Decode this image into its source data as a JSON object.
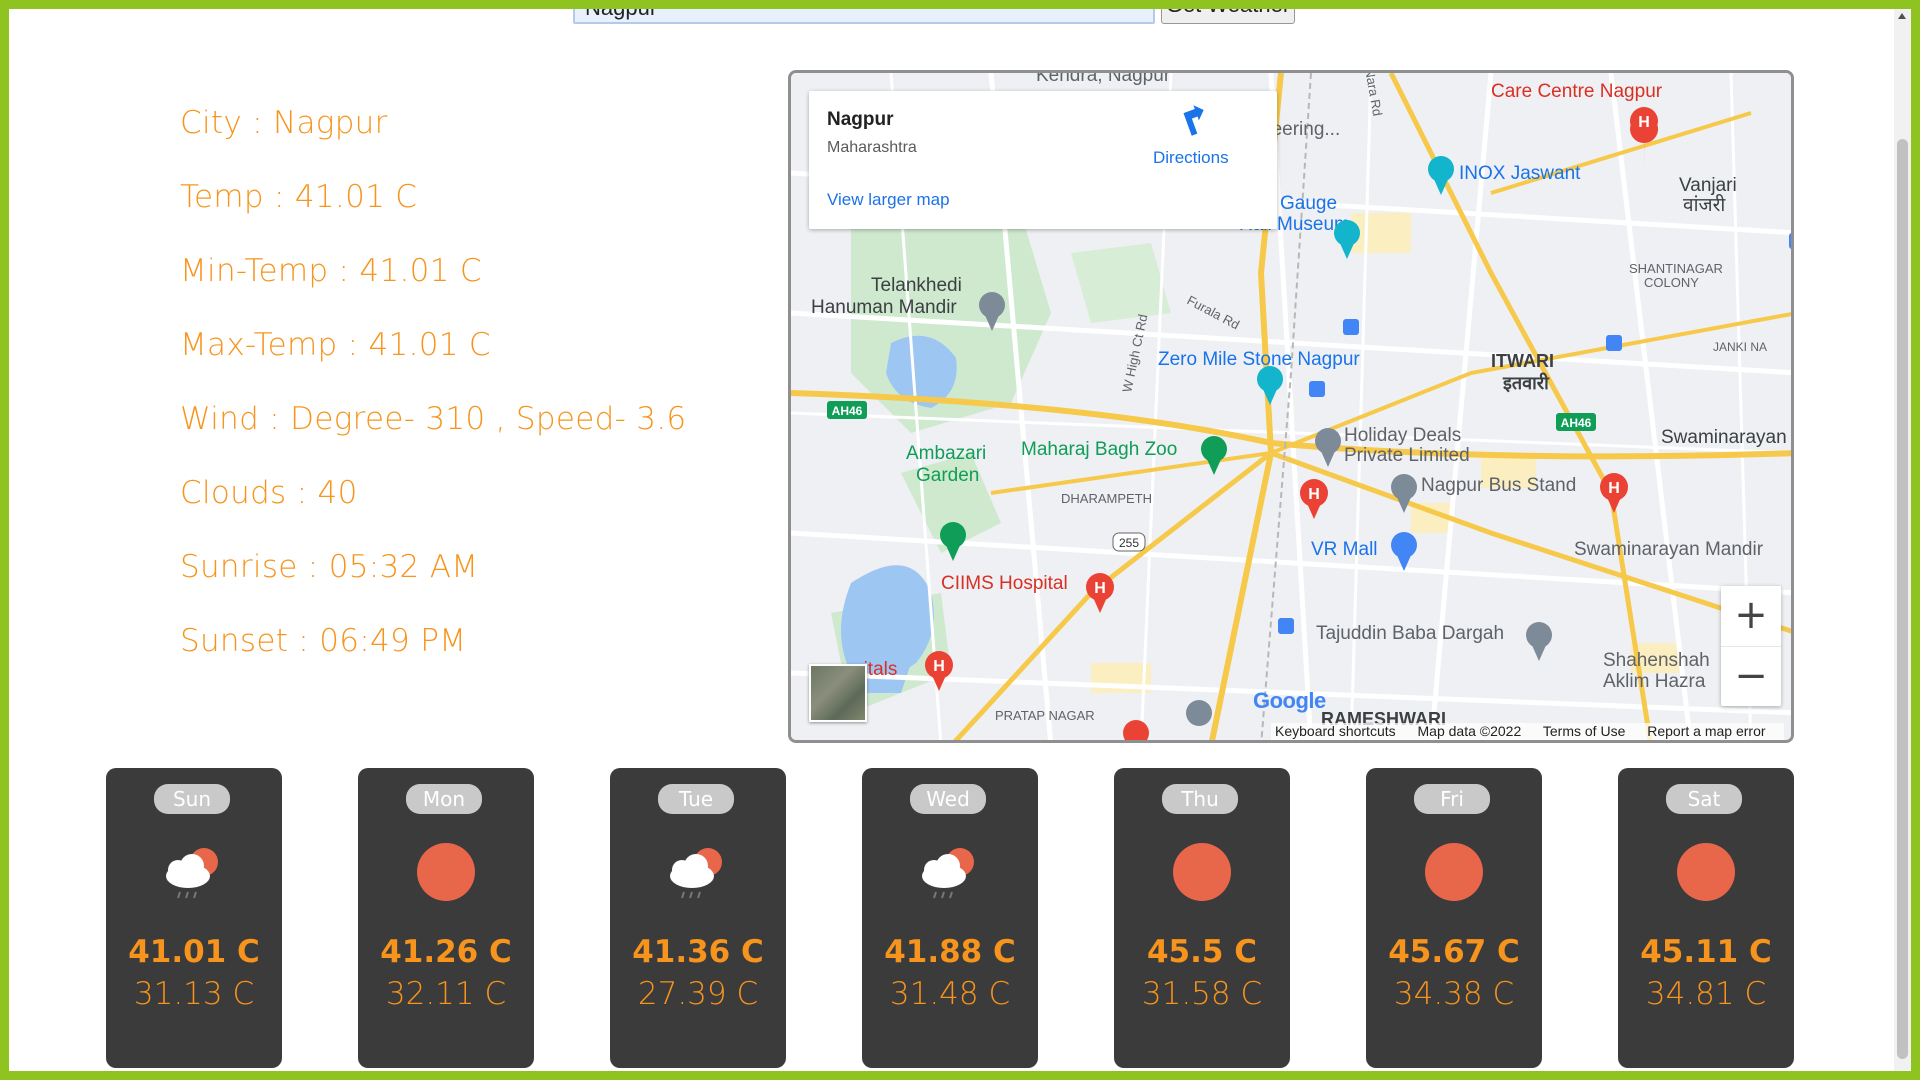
{
  "search": {
    "value": "Nagpur",
    "button_label": "Get Weather"
  },
  "info": {
    "city": "City : Nagpur",
    "temp": "Temp : 41.01 C",
    "min_temp": "Min-Temp : 41.01 C",
    "max_temp": "Max-Temp : 41.01 C",
    "wind": "Wind : Degree- 310 , Speed- 3.6",
    "clouds": "Clouds : 40",
    "sunrise": "Sunrise : 05:32 AM",
    "sunset": "Sunset : 06:49 PM"
  },
  "map": {
    "place_name": "Nagpur",
    "region": "Maharashtra",
    "directions_label": "Directions",
    "view_larger": "View larger map",
    "zoom_in": "+",
    "zoom_out": "−",
    "google": "Google",
    "attribution": {
      "shortcuts": "Keyboard shortcuts",
      "map_data": "Map data ©2022",
      "terms": "Terms of Use",
      "report": "Report a map error"
    },
    "labels": [
      "Kendra, Nagpur",
      "Care Centre Nagpur",
      "INOX Jaswant",
      "Vanjari",
      "वांजरी",
      "Rail Museum",
      "Telankhedi",
      "Hanuman Mandir",
      "SHANTINAGAR",
      "COLONY",
      "ITWARI",
      "इतवारी",
      "Zero Mile Stone Nagpur",
      "Holiday Deals",
      "Private Limited",
      "Swaminarayan",
      "Ambazari",
      "Garden",
      "Maharaj Bagh Zoo",
      "DHARAMPETH",
      "Nagpur Bus Stand",
      "VR Mall",
      "Swaminarayan Mandir",
      "CIIMS Hospital",
      "Tajuddin Baba Dargah",
      "Shahenshah",
      "Aklim Hazra",
      "PRATAP NAGAR",
      "RAMESHWARI",
      "AH46",
      "255",
      "Furala Rd",
      "W High Ct Rd",
      "Nara Rd",
      "JANKI NA",
      "pitals",
      "neering...",
      "w Gauge"
    ]
  },
  "forecast": [
    {
      "day": "Sun",
      "icon": "cloud-sun-rain-icon",
      "hi": "41.01 C",
      "lo": "31.13 C"
    },
    {
      "day": "Mon",
      "icon": "sun-icon",
      "hi": "41.26 C",
      "lo": "32.11 C"
    },
    {
      "day": "Tue",
      "icon": "cloud-sun-rain-icon",
      "hi": "41.36 C",
      "lo": "27.39 C"
    },
    {
      "day": "Wed",
      "icon": "cloud-sun-rain-icon",
      "hi": "41.88 C",
      "lo": "31.48 C"
    },
    {
      "day": "Thu",
      "icon": "sun-icon",
      "hi": "45.5 C",
      "lo": "31.58 C"
    },
    {
      "day": "Fri",
      "icon": "sun-icon",
      "hi": "45.67 C",
      "lo": "34.38 C"
    },
    {
      "day": "Sat",
      "icon": "sun-icon",
      "hi": "45.11 C",
      "lo": "34.81 C"
    }
  ],
  "colors": {
    "accent": "#f7941d",
    "card_bg": "#3b3b3b",
    "frame": "#8fc31f",
    "sun": "#e8674a"
  }
}
